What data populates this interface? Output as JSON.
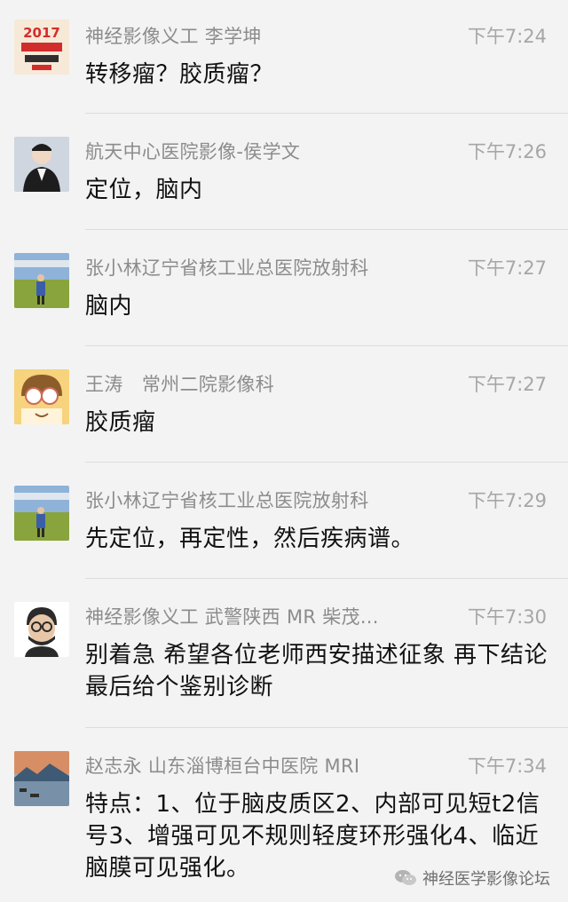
{
  "messages": [
    {
      "sender": "神经影像义工 李学坤",
      "time": "下午7:24",
      "text": "转移瘤？胶质瘤？",
      "avatar_icon": "poster-2017-avatar",
      "avatar_badge": "2017",
      "avatar_colors": [
        "#f7e9d7",
        "#d22d2d",
        "#2f2f2f"
      ]
    },
    {
      "sender": "航天中心医院影像-侯学文",
      "time": "下午7:26",
      "text": "定位，脑内",
      "avatar_icon": "portrait-man-avatar",
      "avatar_colors": [
        "#cfd6df",
        "#1d1d1d",
        "#f0d8c4"
      ]
    },
    {
      "sender": "张小林辽宁省核工业总医院放射科",
      "time": "下午7:27",
      "text": "脑内",
      "avatar_icon": "landscape-person-avatar",
      "avatar_colors": [
        "#8fb2d9",
        "#89a43c",
        "#3b5ea8"
      ]
    },
    {
      "sender": "王涛　常州二院影像科",
      "time": "下午7:27",
      "text": "胶质瘤",
      "avatar_icon": "cartoon-glasses-avatar",
      "avatar_colors": [
        "#f6d37c",
        "#ffffff",
        "#8d5c2b"
      ]
    },
    {
      "sender": "张小林辽宁省核工业总医院放射科",
      "time": "下午7:29",
      "text": "先定位，再定性，然后疾病谱。",
      "avatar_icon": "landscape-person-avatar",
      "avatar_colors": [
        "#8fb2d9",
        "#89a43c",
        "#3b5ea8"
      ]
    },
    {
      "sender": "神经影像义工 武警陕西 MR 柴茂...",
      "time": "下午7:30",
      "text": "别着急  希望各位老师西安描述征象  再下结论 最后给个鉴别诊断",
      "avatar_icon": "cartoon-man-glasses-avatar",
      "avatar_colors": [
        "#ffffff",
        "#2a2a2a",
        "#e8c7a8"
      ]
    },
    {
      "sender": "赵志永 山东淄博桓台中医院 MRI",
      "time": "下午7:34",
      "text": "特点：1、位于脑皮质区2、内部可见短t2信号3、增强可见不规则轻度环形强化4、临近脑膜可见强化。",
      "avatar_icon": "sunset-lake-avatar",
      "avatar_colors": [
        "#d88e64",
        "#3f5a74",
        "#9db0c4"
      ]
    }
  ],
  "watermark": {
    "icon": "wechat-icon",
    "label": "神经医学影像论坛"
  }
}
